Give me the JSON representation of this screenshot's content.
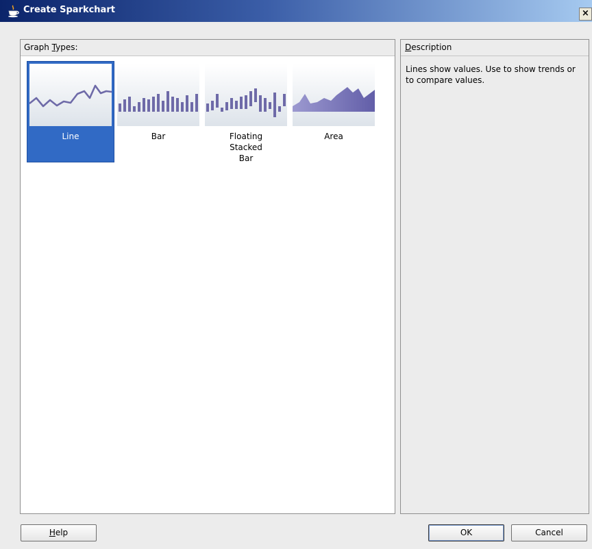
{
  "window": {
    "title": "Create Sparkchart",
    "close_glyph": "×"
  },
  "graph_types": {
    "header_prefix": "Graph ",
    "header_mnemonic": "T",
    "header_suffix": "ypes:",
    "items": [
      {
        "label": "Line",
        "icon": "line-chart-icon",
        "selected": true
      },
      {
        "label": "Bar",
        "icon": "bar-chart-icon",
        "selected": false
      },
      {
        "label": "Floating Stacked Bar",
        "icon": "floating-stacked-bar-icon",
        "selected": false
      },
      {
        "label": "Area",
        "icon": "area-chart-icon",
        "selected": false
      }
    ]
  },
  "description": {
    "header_mnemonic": "D",
    "header_suffix": "escription",
    "text": "Lines show values. Use to show trends or to compare values."
  },
  "buttons": {
    "help_mnemonic": "H",
    "help_suffix": "elp",
    "ok": "OK",
    "cancel": "Cancel"
  },
  "colors": {
    "selection": "#316ac5",
    "chart_purple": "#6e6aa8"
  }
}
